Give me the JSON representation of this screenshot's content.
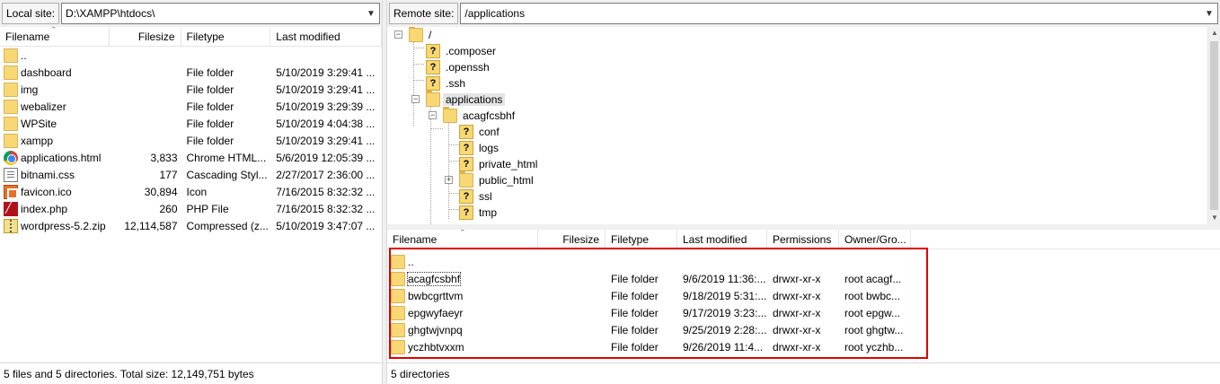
{
  "local": {
    "site_label": "Local site:",
    "site_path": "D:\\XAMPP\\htdocs\\",
    "columns": [
      "Filename",
      "Filesize",
      "Filetype",
      "Last modified"
    ],
    "rows": [
      {
        "name": "..",
        "size": "",
        "type": "",
        "modified": "",
        "icon": "folder-icon"
      },
      {
        "name": "dashboard",
        "size": "",
        "type": "File folder",
        "modified": "5/10/2019 3:29:41 ...",
        "icon": "folder-icon"
      },
      {
        "name": "img",
        "size": "",
        "type": "File folder",
        "modified": "5/10/2019 3:29:41 ...",
        "icon": "folder-icon"
      },
      {
        "name": "webalizer",
        "size": "",
        "type": "File folder",
        "modified": "5/10/2019 3:29:39 ...",
        "icon": "folder-icon"
      },
      {
        "name": "WPSite",
        "size": "",
        "type": "File folder",
        "modified": "5/10/2019 4:04:38 ...",
        "icon": "folder-icon"
      },
      {
        "name": "xampp",
        "size": "",
        "type": "File folder",
        "modified": "5/10/2019 3:29:41 ...",
        "icon": "folder-icon"
      },
      {
        "name": "applications.html",
        "size": "3,833",
        "type": "Chrome HTML...",
        "modified": "5/6/2019 12:05:39 ...",
        "icon": "chrome-icon"
      },
      {
        "name": "bitnami.css",
        "size": "177",
        "type": "Cascading Styl...",
        "modified": "2/27/2017 2:36:00 ...",
        "icon": "css-file-icon"
      },
      {
        "name": "favicon.ico",
        "size": "30,894",
        "type": "Icon",
        "modified": "7/16/2015 8:32:32 ...",
        "icon": "favicon-icon"
      },
      {
        "name": "index.php",
        "size": "260",
        "type": "PHP File",
        "modified": "7/16/2015 8:32:32 ...",
        "icon": "php-file-icon"
      },
      {
        "name": "wordpress-5.2.zip",
        "size": "12,114,587",
        "type": "Compressed (z...",
        "modified": "5/10/2019 3:47:07 ...",
        "icon": "zip-icon"
      }
    ],
    "status": "5 files and 5 directories. Total size: 12,149,751 bytes"
  },
  "remote": {
    "site_label": "Remote site:",
    "site_path": "/applications",
    "tree": [
      {
        "label": "/",
        "icon": "folder-icon",
        "selected": false
      },
      {
        "label": ".composer",
        "icon": "unknown-folder-icon",
        "selected": false
      },
      {
        "label": ".openssh",
        "icon": "unknown-folder-icon",
        "selected": false
      },
      {
        "label": ".ssh",
        "icon": "unknown-folder-icon",
        "selected": false
      },
      {
        "label": "applications",
        "icon": "folder-icon",
        "selected": true
      },
      {
        "label": "acagfcsbhf",
        "icon": "folder-icon",
        "selected": false
      },
      {
        "label": "conf",
        "icon": "unknown-folder-icon",
        "selected": false
      },
      {
        "label": "logs",
        "icon": "unknown-folder-icon",
        "selected": false
      },
      {
        "label": "private_html",
        "icon": "unknown-folder-icon",
        "selected": false
      },
      {
        "label": "public_html",
        "icon": "folder-icon",
        "selected": false
      },
      {
        "label": "ssl",
        "icon": "unknown-folder-icon",
        "selected": false
      },
      {
        "label": "tmp",
        "icon": "unknown-folder-icon",
        "selected": false
      }
    ],
    "columns": [
      "Filename",
      "Filesize",
      "Filetype",
      "Last modified",
      "Permissions",
      "Owner/Gro..."
    ],
    "rows": [
      {
        "name": "..",
        "size": "",
        "type": "",
        "modified": "",
        "perms": "",
        "owner": ""
      },
      {
        "name": "acagfcsbhf",
        "size": "",
        "type": "File folder",
        "modified": "9/6/2019 11:36:...",
        "perms": "drwxr-xr-x",
        "owner": "root acagf..."
      },
      {
        "name": "bwbcgrttvm",
        "size": "",
        "type": "File folder",
        "modified": "9/18/2019 5:31:...",
        "perms": "drwxr-xr-x",
        "owner": "root bwbc..."
      },
      {
        "name": "epgwyfaeyr",
        "size": "",
        "type": "File folder",
        "modified": "9/17/2019 3:23:...",
        "perms": "drwxr-xr-x",
        "owner": "root epgw..."
      },
      {
        "name": "ghgtwjvnpq",
        "size": "",
        "type": "File folder",
        "modified": "9/25/2019 2:28:...",
        "perms": "drwxr-xr-x",
        "owner": "root ghgtw..."
      },
      {
        "name": "yczhbtvxxm",
        "size": "",
        "type": "File folder",
        "modified": "9/26/2019 11:4...",
        "perms": "drwxr-xr-x",
        "owner": "root yczhb..."
      }
    ],
    "status": "5 directories"
  },
  "colors": {
    "highlight_border": "#e00000",
    "folder": "#f8d775"
  }
}
